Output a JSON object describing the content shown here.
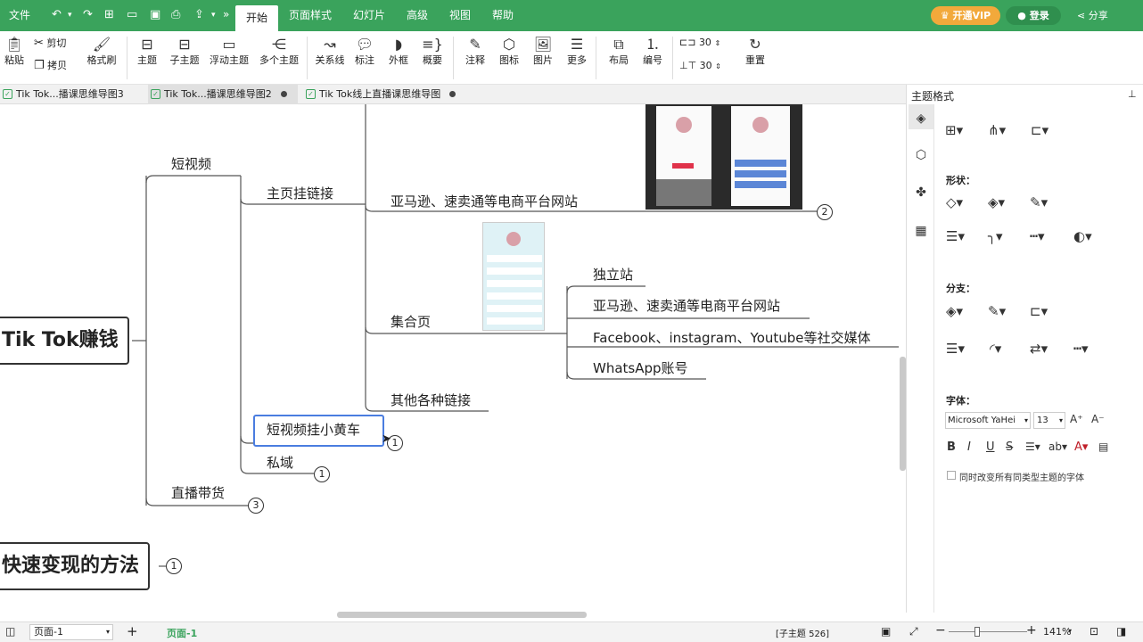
{
  "menubar": {
    "file": "文件",
    "tabs": [
      "开始",
      "页面样式",
      "幻灯片",
      "高级",
      "视图",
      "帮助"
    ],
    "vip": "开通VIP",
    "login": "登录",
    "share": "分享"
  },
  "ribbon": {
    "paste": "粘贴",
    "cut": "剪切",
    "copy": "拷贝",
    "format_painter": "格式刷",
    "topic": "主题",
    "subtopic": "子主题",
    "floating": "浮动主题",
    "multi": "多个主题",
    "relation": "关系线",
    "label": "标注",
    "boundary": "外框",
    "summary": "概要",
    "note": "注释",
    "icon": "图标",
    "image": "图片",
    "more": "更多",
    "layout": "布局",
    "numbering": "编号",
    "spacing_h": "30",
    "spacing_v": "30",
    "reset": "重置"
  },
  "doc_tabs": [
    {
      "label": "Tik Tok...播课思维导图3"
    },
    {
      "label": "Tik Tok...播课思维导图2"
    },
    {
      "label": "Tik Tok线上直播课思维导图"
    }
  ],
  "mindmap": {
    "root": "Tik Tok赚钱",
    "other_root": "快速变现的方法",
    "other_root_count": "1",
    "short_video": "短视频",
    "homepage_link": "主页挂链接",
    "amazon": "亚马逊、速卖通等电商平台网站",
    "amazon_count": "2",
    "collection": "集合页",
    "standalone": "独立站",
    "amazon2": "亚马逊、速卖通等电商平台网站",
    "social": "Facebook、instagram、Youtube等社交媒体",
    "whatsapp": "WhatsApp账号",
    "other_links": "其他各种链接",
    "cart": "短视频挂小黄车",
    "cart_count": "1",
    "private": "私域",
    "private_count": "1",
    "live": "直播带货",
    "live_count": "3"
  },
  "sidepanel": {
    "title": "主题格式",
    "shape": "形状：",
    "branch": "分支：",
    "font": "字体：",
    "font_name": "Microsoft YaHei",
    "font_size": "13",
    "change_all": "同时改变所有同类型主题的字体"
  },
  "statusbar": {
    "page_select": "页面-1",
    "page_tab": "页面-1",
    "subtopics": "[子主题 526]",
    "zoom": "141%"
  }
}
